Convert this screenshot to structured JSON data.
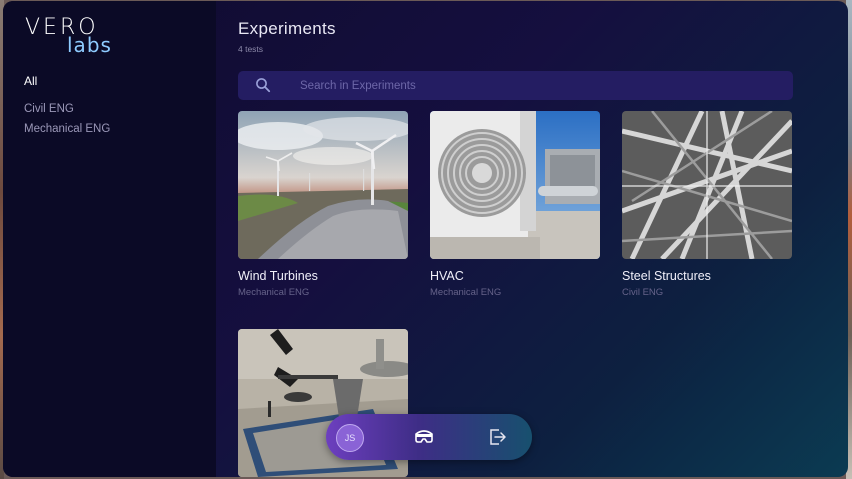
{
  "brand": {
    "name_part1": "VERO",
    "name_part2": "labs"
  },
  "sidebar": {
    "items": [
      {
        "label": "All",
        "active": true
      },
      {
        "label": "Civil ENG",
        "active": false
      },
      {
        "label": "Mechanical ENG",
        "active": false
      }
    ]
  },
  "header": {
    "title": "Experiments",
    "subtitle": "4 tests"
  },
  "search": {
    "placeholder": "Search in Experiments",
    "value": "",
    "icon": "search-icon"
  },
  "experiments": [
    {
      "title": "Wind Turbines",
      "category": "Mechanical ENG"
    },
    {
      "title": "HVAC",
      "category": "Mechanical ENG"
    },
    {
      "title": "Steel Structures",
      "category": "Civil ENG"
    },
    {
      "title": "",
      "category": ""
    }
  ],
  "dock": {
    "avatar_initials": "JS",
    "items": [
      {
        "icon": "vr-headset-icon"
      },
      {
        "icon": "logout-icon"
      }
    ]
  },
  "colors": {
    "sidebar": "#0b0a26",
    "search_bg": "#241d62",
    "accent": "#8ecbff"
  }
}
